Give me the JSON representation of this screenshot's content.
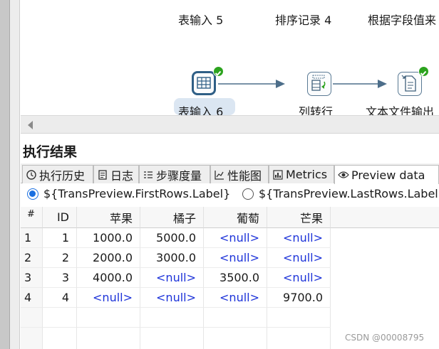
{
  "canvas": {
    "top_steps": [
      "表输入 5",
      "排序记录 4",
      "根据字段值来"
    ],
    "bottom_steps": [
      {
        "label": "表输入 6",
        "icon": "table-input-icon",
        "selected": true,
        "status": "ok"
      },
      {
        "label": "列转行",
        "icon": "row-denormalizer-icon",
        "selected": false
      },
      {
        "label": "文本文件输出",
        "icon": "text-file-output-icon",
        "selected": false,
        "status": "ok"
      }
    ]
  },
  "results": {
    "title": "执行结果",
    "tabs": [
      {
        "label": "执行历史",
        "icon": "history-icon"
      },
      {
        "label": "日志",
        "icon": "log-icon"
      },
      {
        "label": "步骤度量",
        "icon": "step-metrics-icon"
      },
      {
        "label": "性能图",
        "icon": "performance-chart-icon"
      },
      {
        "label": "Metrics",
        "icon": "metrics-icon"
      },
      {
        "label": "Preview data",
        "icon": "eye-icon",
        "active": true
      }
    ],
    "radios": [
      {
        "label": "${TransPreview.FirstRows.Label}",
        "checked": true
      },
      {
        "label": "${TransPreview.LastRows.Label}",
        "checked": false
      }
    ]
  },
  "table": {
    "columns": [
      "#",
      "ID",
      "苹果",
      "橘子",
      "葡萄",
      "芒果"
    ],
    "rows": [
      [
        "1",
        "1",
        "1000.0",
        "5000.0",
        "<null>",
        "<null>"
      ],
      [
        "2",
        "2",
        "2000.0",
        "3000.0",
        "<null>",
        "<null>"
      ],
      [
        "3",
        "3",
        "4000.0",
        "<null>",
        "3500.0",
        "<null>"
      ],
      [
        "4",
        "4",
        "<null>",
        "<null>",
        "<null>",
        "9700.0"
      ]
    ]
  },
  "watermark": "CSDN @00008795",
  "colors": {
    "accent": "#2f5f86",
    "ok": "#2ca31e",
    "null_text": "#1d33d9"
  }
}
